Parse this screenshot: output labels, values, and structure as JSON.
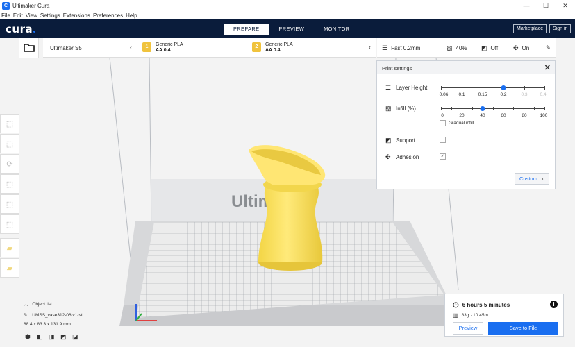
{
  "window": {
    "app_icon_glyph": "C",
    "title": "Ultimaker Cura",
    "minimize_glyph": "—",
    "maximize_glyph": "☐",
    "close_glyph": "✕"
  },
  "menu": [
    "File",
    "Edit",
    "View",
    "Settings",
    "Extensions",
    "Preferences",
    "Help"
  ],
  "header": {
    "logo": "cura",
    "tabs": [
      "PREPARE",
      "PREVIEW",
      "MONITOR"
    ],
    "active_tab": "PREPARE",
    "marketplace": "Marketplace",
    "signin": "Sign in"
  },
  "printer": {
    "name": "Ultimaker S5",
    "chevron": "‹"
  },
  "extruders": [
    {
      "number": "1",
      "material": "Generic PLA",
      "nozzle": "AA 0.4"
    },
    {
      "number": "2",
      "material": "Generic PLA",
      "nozzle": "AA 0.4"
    }
  ],
  "extruder_chevron": "‹",
  "settings_bar": {
    "profile": "Fast 0.2mm",
    "infill": "40%",
    "support": "Off",
    "adhesion": "On"
  },
  "print_settings": {
    "title": "Print settings",
    "close_glyph": "✕",
    "layer_height": {
      "label": "Layer Height",
      "ticks": [
        "0.06",
        "0.1",
        "0.15",
        "0.2",
        "0.3",
        "0.4"
      ],
      "selected": "0.2",
      "unavailable": [
        "0.3",
        "0.4"
      ]
    },
    "infill": {
      "label": "Infill (%)",
      "ticks": [
        "0",
        "20",
        "40",
        "60",
        "80",
        "100"
      ],
      "value": 40
    },
    "gradual_infill": {
      "label": "Gradual infill",
      "checked": false
    },
    "support": {
      "label": "Support",
      "checked": false
    },
    "adhesion": {
      "label": "Adhesion",
      "checked": true,
      "check_glyph": "✓"
    },
    "custom_button": "Custom",
    "custom_chevron": "›"
  },
  "object_list": {
    "title": "Object list",
    "expand_glyph": "︿",
    "filename": "UMSS_vase312-06 v1-stl",
    "dimensions": "88.4 x 83.3 x 131.9 mm"
  },
  "view_buttons": [
    "3d-view",
    "front-view",
    "top-view",
    "left-view",
    "right-view"
  ],
  "print_estimate": {
    "time": "6 hours 5 minutes",
    "material": "83g · 10.45m",
    "info_glyph": "i",
    "preview_button": "Preview",
    "save_button": "Save to File"
  },
  "build_plate_text": "Ultimaker",
  "colors": {
    "accent": "#196ef0",
    "header": "#0a1c3b",
    "model": "#ffe670",
    "extruder_badge": "#f0c33d"
  }
}
